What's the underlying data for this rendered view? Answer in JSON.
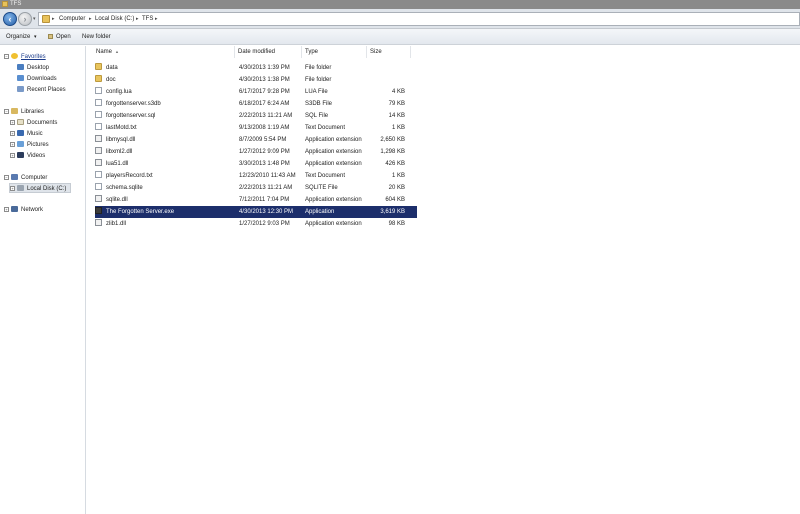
{
  "window": {
    "title": "TFS"
  },
  "address": {
    "recent_glyph": "▾",
    "crumbs": [
      "Computer",
      "Local Disk (C:)",
      "TFS"
    ],
    "separator": "▸"
  },
  "toolbar": {
    "organize_label": "Organize",
    "organize_arrow": "▾",
    "open_label": "Open",
    "new_folder_label": "New folder"
  },
  "nav": {
    "favorites": {
      "label": "Favorites",
      "items": [
        "Desktop",
        "Downloads",
        "Recent Places"
      ]
    },
    "libraries": {
      "label": "Libraries",
      "items": [
        "Documents",
        "Music",
        "Pictures",
        "Videos"
      ]
    },
    "computer": {
      "label": "Computer",
      "items": [
        "Local Disk (C:)"
      ]
    },
    "network": {
      "label": "Network"
    },
    "expander_collapsed": "+",
    "expander_expanded": "−"
  },
  "columns": {
    "name": "Name",
    "date": "Date modified",
    "type": "Type",
    "size": "Size",
    "sort_glyph": "▲"
  },
  "files": [
    {
      "name": "data",
      "date": "4/30/2013 1:39 PM",
      "type": "File folder",
      "size": "",
      "icon": "folder-icon"
    },
    {
      "name": "doc",
      "date": "4/30/2013 1:38 PM",
      "type": "File folder",
      "size": "",
      "icon": "folder-icon"
    },
    {
      "name": "config.lua",
      "date": "6/17/2017 9:28 PM",
      "type": "LUA File",
      "size": "4 KB",
      "icon": "file-icon"
    },
    {
      "name": "forgottenserver.s3db",
      "date": "6/18/2017 6:24 AM",
      "type": "S3DB File",
      "size": "79 KB",
      "icon": "file-icon"
    },
    {
      "name": "forgottenserver.sql",
      "date": "2/22/2013 11:21 AM",
      "type": "SQL File",
      "size": "14 KB",
      "icon": "file-icon"
    },
    {
      "name": "lastMotd.txt",
      "date": "9/13/2008 1:19 AM",
      "type": "Text Document",
      "size": "1 KB",
      "icon": "file-icon"
    },
    {
      "name": "libmysql.dll",
      "date": "8/7/2009 5:54 PM",
      "type": "Application extension",
      "size": "2,650 KB",
      "icon": "dll-icon"
    },
    {
      "name": "libxml2.dll",
      "date": "1/27/2012 9:09 PM",
      "type": "Application extension",
      "size": "1,298 KB",
      "icon": "dll-icon"
    },
    {
      "name": "lua51.dll",
      "date": "3/30/2013 1:48 PM",
      "type": "Application extension",
      "size": "426 KB",
      "icon": "dll-icon"
    },
    {
      "name": "playersRecord.txt",
      "date": "12/23/2010 11:43 AM",
      "type": "Text Document",
      "size": "1 KB",
      "icon": "file-icon"
    },
    {
      "name": "schema.sqlite",
      "date": "2/22/2013 11:21 AM",
      "type": "SQLITE File",
      "size": "20 KB",
      "icon": "file-icon"
    },
    {
      "name": "sqlite.dll",
      "date": "7/12/2011 7:04 PM",
      "type": "Application extension",
      "size": "604 KB",
      "icon": "dll-icon"
    },
    {
      "name": "The Forgotten Server.exe",
      "date": "4/30/2013 12:30 PM",
      "type": "Application",
      "size": "3,619 KB",
      "icon": "exe-icon",
      "selected": true
    },
    {
      "name": "zlib1.dll",
      "date": "1/27/2012 9:03 PM",
      "type": "Application extension",
      "size": "98 KB",
      "icon": "dll-icon"
    }
  ],
  "colors": {
    "selection": "#1c2e6b",
    "title_bar": "#8a8a8a",
    "folder": "#e9c55e",
    "link": "#1a3a8a"
  }
}
